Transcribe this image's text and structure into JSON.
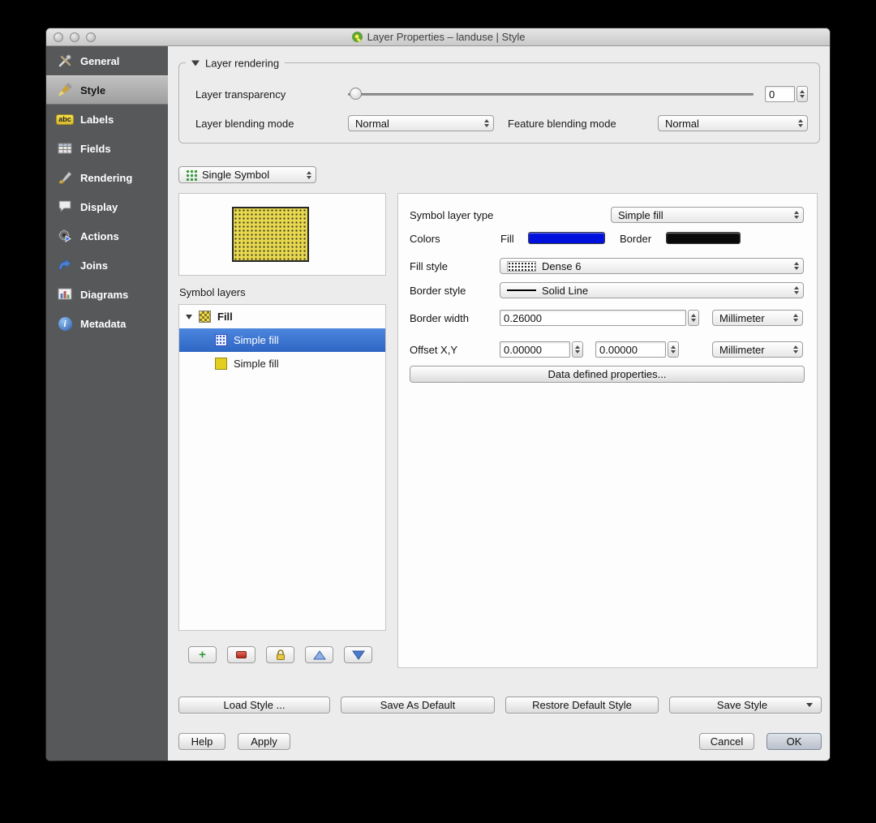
{
  "window": {
    "title": "Layer Properties – landuse | Style"
  },
  "sidebar": {
    "items": [
      {
        "label": "General"
      },
      {
        "label": "Style"
      },
      {
        "label": "Labels"
      },
      {
        "label": "Fields"
      },
      {
        "label": "Rendering"
      },
      {
        "label": "Display"
      },
      {
        "label": "Actions"
      },
      {
        "label": "Joins"
      },
      {
        "label": "Diagrams"
      },
      {
        "label": "Metadata"
      }
    ]
  },
  "layer_rendering": {
    "title": "Layer rendering",
    "transparency_label": "Layer transparency",
    "transparency_value": "0",
    "blending_label": "Layer blending mode",
    "blending_value": "Normal",
    "feature_blending_label": "Feature blending mode",
    "feature_blending_value": "Normal"
  },
  "renderer": {
    "value": "Single Symbol"
  },
  "symbol_layers": {
    "label": "Symbol layers",
    "tree": [
      {
        "label": "Fill"
      },
      {
        "label": "Simple fill"
      },
      {
        "label": "Simple fill"
      }
    ]
  },
  "properties": {
    "symbol_layer_type_label": "Symbol layer type",
    "symbol_layer_type_value": "Simple fill",
    "colors_label": "Colors",
    "fill_label": "Fill",
    "border_label": "Border",
    "fill_style_label": "Fill style",
    "fill_style_value": "Dense 6",
    "border_style_label": "Border style",
    "border_style_value": "Solid Line",
    "border_width_label": "Border width",
    "border_width_value": "0.26000",
    "border_width_unit": "Millimeter",
    "offset_label": "Offset X,Y",
    "offset_x_value": "0.00000",
    "offset_y_value": "0.00000",
    "offset_unit": "Millimeter",
    "data_defined_button": "Data defined properties..."
  },
  "style_actions": {
    "load_label": "Load Style ...",
    "save_default_label": "Save As Default",
    "restore_label": "Restore Default Style",
    "save_style_label": "Save Style"
  },
  "footer": {
    "help": "Help",
    "apply": "Apply",
    "cancel": "Cancel",
    "ok": "OK"
  },
  "icons": {
    "labels_abc": "abc",
    "metadata_i": "i",
    "add_plus": "+"
  },
  "colors": {
    "fill_well": "#0010dd",
    "border_well": "#0a0a0a",
    "tree_selection": "#3875d7",
    "sidebar_bg": "#57585a"
  }
}
